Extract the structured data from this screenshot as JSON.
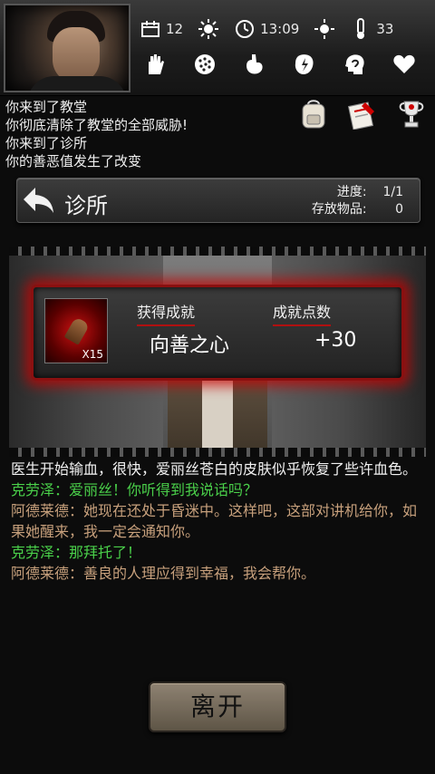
{
  "status": {
    "days": "12",
    "time": "13:09",
    "temperature": "33"
  },
  "status_icons": [
    "hand-icon",
    "pills-icon",
    "stomach-icon",
    "energy-icon",
    "mind-icon",
    "heart-icon"
  ],
  "log": [
    "你来到了教堂",
    "你彻底清除了教堂的全部威胁!",
    "你来到了诊所",
    "你的善恶值发生了改变"
  ],
  "tools": [
    "backpack-icon",
    "notes-icon",
    "trophy-icon"
  ],
  "location": {
    "name": "诊所",
    "progress_label": "进度:",
    "progress_value": "1/1",
    "storage_label": "存放物品:",
    "storage_value": "0"
  },
  "achievement": {
    "item_qty": "X15",
    "header_title": "获得成就",
    "header_points": "成就点数",
    "title": "向善之心",
    "points": "+30"
  },
  "dialogue": [
    {
      "text": "医生开始输血，很快，爱丽丝苍白的皮肤似乎恢复了些许血色。",
      "color": "white"
    },
    {
      "text": "克劳泽：爱丽丝！你听得到我说话吗？",
      "color": "green"
    },
    {
      "text": "阿德莱德：她现在还处于昏迷中。这样吧，这部对讲机给你，如果她醒来，我一定会通知你。",
      "color": "brown"
    },
    {
      "text": "克劳泽：那拜托了！",
      "color": "green"
    },
    {
      "text": "阿德莱德：善良的人理应得到幸福，我会帮你。",
      "color": "brown"
    }
  ],
  "leave_label": "离开",
  "colors": {
    "accent_red": "#b01010",
    "dialogue_green": "#4ad04a",
    "dialogue_brown": "#c7a07c"
  }
}
